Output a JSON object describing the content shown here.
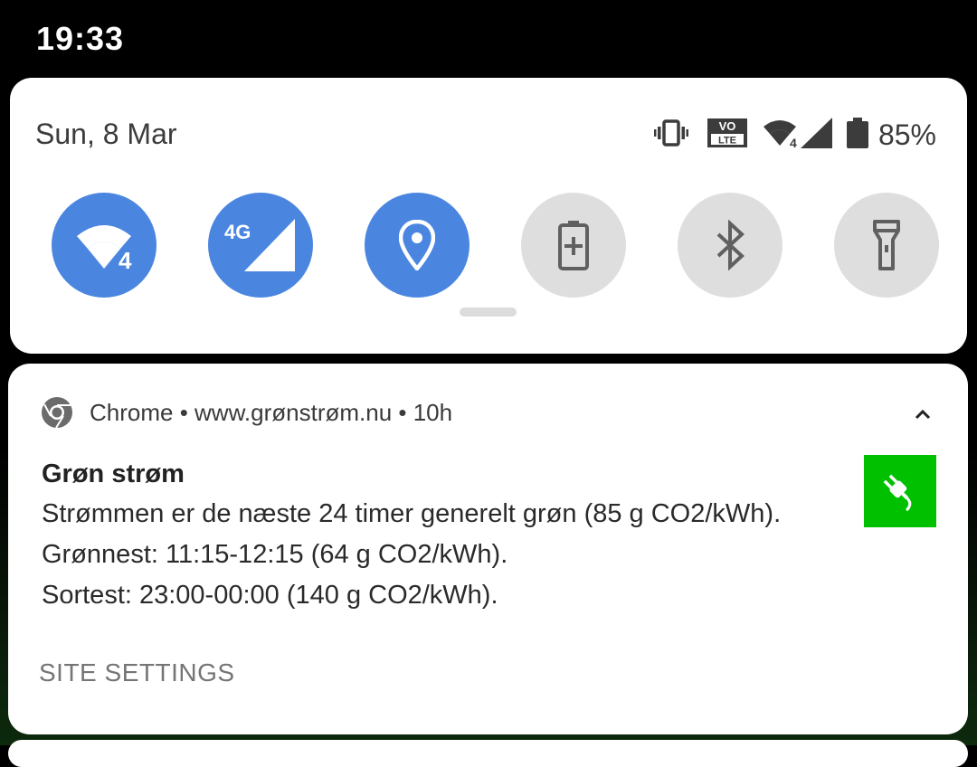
{
  "status_bar": {
    "time": "19:33"
  },
  "quick_settings": {
    "date": "Sun, 8 Mar",
    "status_icons": [
      "vibrate-icon",
      "volte-icon",
      "wifi-4-icon",
      "cell-signal-icon",
      "battery-icon"
    ],
    "volte_label_top": "VO",
    "volte_label_bottom": "LTE",
    "wifi_badge": "4",
    "battery_percent": "85%",
    "tiles": [
      {
        "name": "wifi",
        "icon": "wifi-icon",
        "badge": "4",
        "state": "on"
      },
      {
        "name": "mobile-data",
        "icon": "cell-signal-icon",
        "badge": "4G",
        "state": "on"
      },
      {
        "name": "location",
        "icon": "location-pin-icon",
        "state": "on"
      },
      {
        "name": "battery-saver",
        "icon": "battery-plus-icon",
        "state": "off"
      },
      {
        "name": "bluetooth",
        "icon": "bluetooth-icon",
        "state": "off"
      },
      {
        "name": "flashlight",
        "icon": "flashlight-icon",
        "state": "off"
      }
    ],
    "colors": {
      "tile_on": "#4a86e0",
      "tile_off": "#dedede"
    }
  },
  "notification": {
    "app_name": "Chrome",
    "header": "Chrome • www.grønstrøm.nu • 10h",
    "title": "Grøn strøm",
    "lines": [
      "Strømmen er de næste 24 timer generelt grøn (85 g CO2/kWh).",
      "Grønnest: 11:15-12:15 (64 g CO2/kWh).",
      "Sortest: 23:00-00:00 (140 g CO2/kWh)."
    ],
    "action": "SITE SETTINGS",
    "large_icon": "power-plug-icon",
    "large_icon_color": "#00c000"
  }
}
